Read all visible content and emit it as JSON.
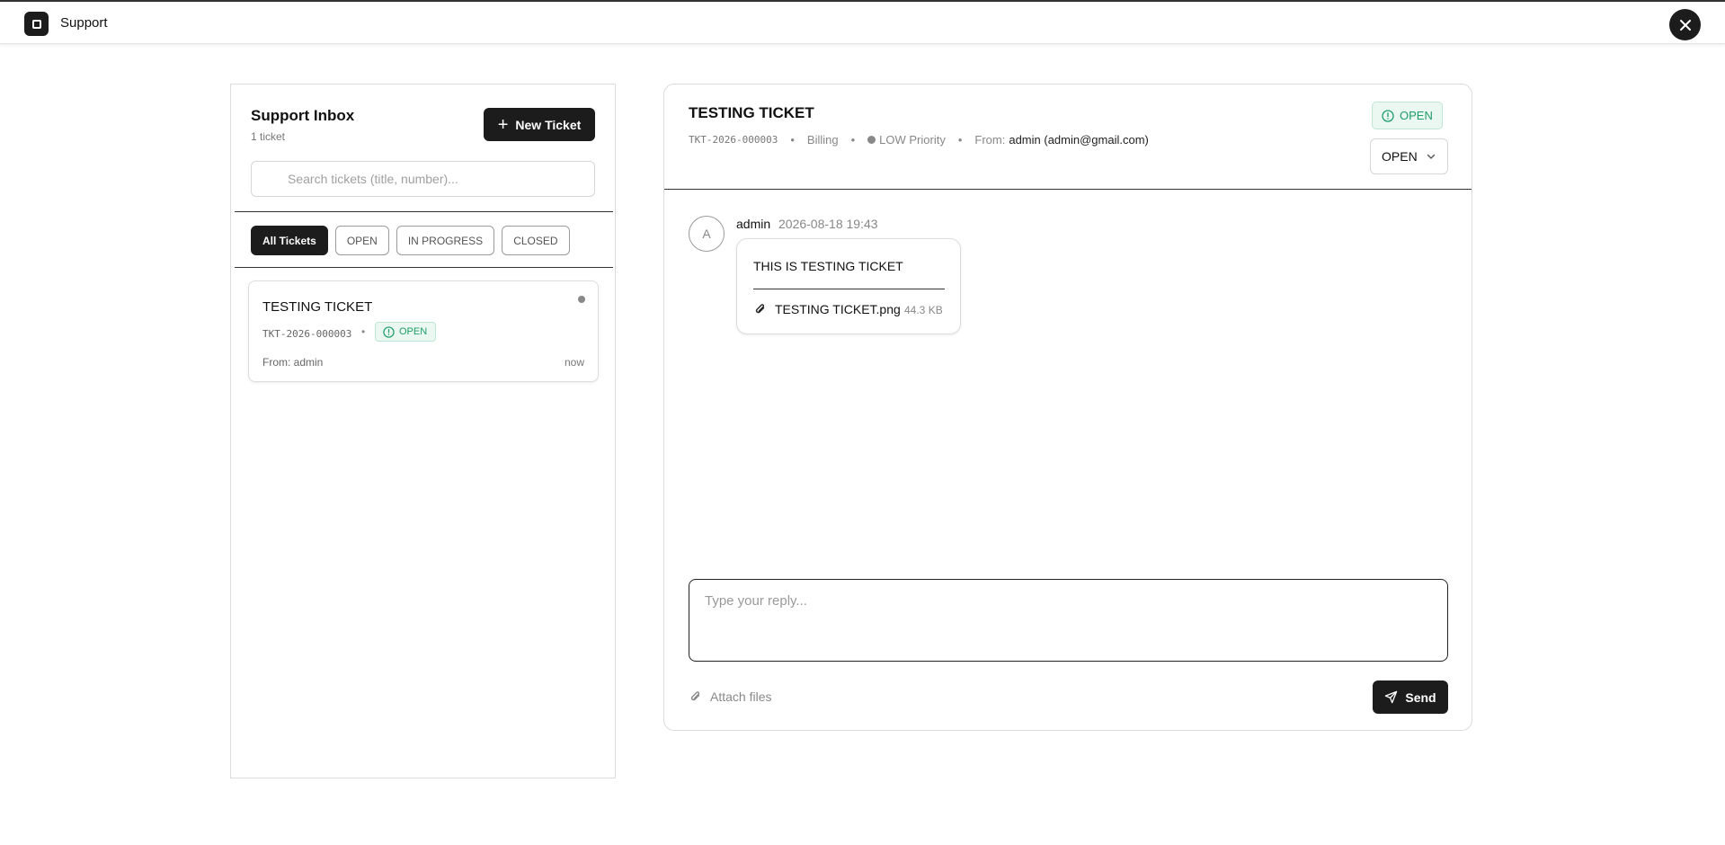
{
  "app": {
    "title": "Support"
  },
  "inbox": {
    "title": "Support Inbox",
    "count": "1 ticket",
    "new_ticket_label": "New Ticket",
    "search_placeholder": "Search tickets (title, number)...",
    "filters": [
      {
        "label": "All Tickets",
        "active": true
      },
      {
        "label": "OPEN",
        "active": false
      },
      {
        "label": "IN PROGRESS",
        "active": false
      },
      {
        "label": "CLOSED",
        "active": false
      }
    ],
    "tickets": [
      {
        "title": "TESTING TICKET",
        "number": "TKT-2026-000003",
        "status": "OPEN",
        "from": "From: admin",
        "time": "now"
      }
    ]
  },
  "detail": {
    "title": "TESTING TICKET",
    "number": "TKT-2026-000003",
    "category": "Billing",
    "priority": "LOW Priority",
    "from_label": "From:",
    "from_value": "admin (admin@gmail.com)",
    "status_badge": "OPEN",
    "status_select": "OPEN",
    "message": {
      "avatar": "A",
      "author": "admin",
      "time": "2026-08-18 19:43",
      "text": "THIS IS TESTING TICKET",
      "attachment_name": "TESTING TICKET.png",
      "attachment_size": "44.3 KB"
    },
    "reply_placeholder": "Type your reply...",
    "attach_label": "Attach files",
    "send_label": "Send"
  },
  "colors": {
    "accent": "#1c1c1c",
    "open_green": "#1f9d6a",
    "open_bg": "#eaf8f1"
  }
}
